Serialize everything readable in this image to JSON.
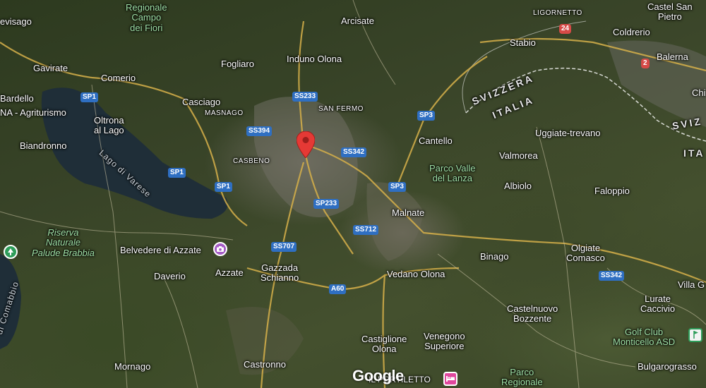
{
  "places": [
    {
      "id": "campo-dei-fiori",
      "text": "Regionale\nCampo\ndei Fiori",
      "kind": "park"
    },
    {
      "id": "visago",
      "text": "evisago",
      "kind": "town"
    },
    {
      "id": "gavirate",
      "text": "Gavirate",
      "kind": "town"
    },
    {
      "id": "comerio",
      "text": "Comerio",
      "kind": "town"
    },
    {
      "id": "bardello",
      "text": "Bardello",
      "kind": "town"
    },
    {
      "id": "agriturismo",
      "text": "NA - Agriturismo",
      "kind": "town"
    },
    {
      "id": "oltrona",
      "text": "Oltrona\nal Lago",
      "kind": "town"
    },
    {
      "id": "biandronno",
      "text": "Biandronno",
      "kind": "town"
    },
    {
      "id": "fogliaro",
      "text": "Fogliaro",
      "kind": "town"
    },
    {
      "id": "casciago",
      "text": "Casciago",
      "kind": "town"
    },
    {
      "id": "masnago",
      "text": "MASNAGO",
      "kind": "district"
    },
    {
      "id": "casbeno",
      "text": "CASBENO",
      "kind": "district"
    },
    {
      "id": "arcisate",
      "text": "Arcisate",
      "kind": "town"
    },
    {
      "id": "induno",
      "text": "Induno Olona",
      "kind": "town"
    },
    {
      "id": "san-fermo",
      "text": "SAN FERMO",
      "kind": "district"
    },
    {
      "id": "ligornetto",
      "text": "LIGORNETTO",
      "kind": "district"
    },
    {
      "id": "stabio",
      "text": "Stabio",
      "kind": "town"
    },
    {
      "id": "castel-san-pietro",
      "text": "Castel San\nPietro",
      "kind": "town"
    },
    {
      "id": "coldrerio",
      "text": "Coldrerio",
      "kind": "town"
    },
    {
      "id": "balerna",
      "text": "Balerna",
      "kind": "town"
    },
    {
      "id": "chi",
      "text": "Chi",
      "kind": "town"
    },
    {
      "id": "cantello",
      "text": "Cantello",
      "kind": "town"
    },
    {
      "id": "uggiate",
      "text": "Uggiate-trevano",
      "kind": "town"
    },
    {
      "id": "valmorea",
      "text": "Valmorea",
      "kind": "town"
    },
    {
      "id": "parco-lanza",
      "text": "Parco Valle\ndel Lanza",
      "kind": "park"
    },
    {
      "id": "albiolo",
      "text": "Albiolo",
      "kind": "town"
    },
    {
      "id": "faloppio",
      "text": "Faloppio",
      "kind": "town"
    },
    {
      "id": "malnate",
      "text": "Malnate",
      "kind": "town"
    },
    {
      "id": "riserva",
      "text": "Riserva\nNaturale\nPalude Brabbia",
      "kind": "park-italic"
    },
    {
      "id": "belvedere",
      "text": "Belvedere di Azzate",
      "kind": "town"
    },
    {
      "id": "azzate",
      "text": "Azzate",
      "kind": "town"
    },
    {
      "id": "daverio",
      "text": "Daverio",
      "kind": "town"
    },
    {
      "id": "gazzada",
      "text": "Gazzada\nSchianno",
      "kind": "town"
    },
    {
      "id": "vedano",
      "text": "Vedano Olona",
      "kind": "town"
    },
    {
      "id": "binago",
      "text": "Binago",
      "kind": "town"
    },
    {
      "id": "olgiate",
      "text": "Olgiate\nComasco",
      "kind": "town"
    },
    {
      "id": "villa-g",
      "text": "Villa G",
      "kind": "town"
    },
    {
      "id": "lurate",
      "text": "Lurate\nCaccivio",
      "kind": "town"
    },
    {
      "id": "castelnuovo",
      "text": "Castelnuovo\nBozzente",
      "kind": "town"
    },
    {
      "id": "golf",
      "text": "Golf Club\nMonticello ASD",
      "kind": "park"
    },
    {
      "id": "castiglione",
      "text": "Castiglione\nOlona",
      "kind": "town"
    },
    {
      "id": "venegono",
      "text": "Venegono\nSuperiore",
      "kind": "town"
    },
    {
      "id": "mornago",
      "text": "Mornago",
      "kind": "town"
    },
    {
      "id": "castronno",
      "text": "Castronno",
      "kind": "town"
    },
    {
      "id": "bulgarograsso",
      "text": "Bulgarograsso",
      "kind": "town"
    },
    {
      "id": "portiletto",
      "text": "IL PORTILETTO",
      "kind": "district"
    },
    {
      "id": "parco-regionale",
      "text": "Parco\nRegionale",
      "kind": "park"
    },
    {
      "id": "comabbio",
      "text": "di Comabbio",
      "kind": "lake"
    },
    {
      "id": "lago-varese",
      "text": "Lago di Varese",
      "kind": "lake"
    },
    {
      "id": "svizzera",
      "text": "SVIZZERA",
      "kind": "border"
    },
    {
      "id": "italia",
      "text": "ITALIA",
      "kind": "border"
    },
    {
      "id": "svizzera-2",
      "text": "SVIZ",
      "kind": "border"
    },
    {
      "id": "italia-2",
      "text": "ITA",
      "kind": "border"
    }
  ],
  "roads": [
    {
      "id": "sp1-a",
      "text": "SP1"
    },
    {
      "id": "sp1-b",
      "text": "SP1"
    },
    {
      "id": "sp1-c",
      "text": "SP1"
    },
    {
      "id": "ss233-a",
      "text": "SS233"
    },
    {
      "id": "ss394",
      "text": "SS394"
    },
    {
      "id": "ss342-a",
      "text": "SS342"
    },
    {
      "id": "sp3-a",
      "text": "SP3"
    },
    {
      "id": "sp3-b",
      "text": "SP3"
    },
    {
      "id": "sp233",
      "text": "SP233"
    },
    {
      "id": "ss712",
      "text": "SS712"
    },
    {
      "id": "ss707",
      "text": "SS707"
    },
    {
      "id": "a60",
      "text": "A60"
    },
    {
      "id": "ss342-b",
      "text": "SS342"
    },
    {
      "id": "r24",
      "text": "24"
    },
    {
      "id": "r2",
      "text": "2"
    }
  ],
  "attribution": "Google",
  "icons": {
    "pin": "location-pin-icon",
    "camera": "camera-icon",
    "hotel": "hotel-icon",
    "tree": "tree-icon",
    "golf": "golf-icon"
  },
  "colors": {
    "pin": "#e53935",
    "road_shield": "#2f6fc2",
    "swiss_road": "#d64a47",
    "lake": "#1f2e38",
    "park_label": "#9fe0a6",
    "major_road": "#d6b04a"
  }
}
